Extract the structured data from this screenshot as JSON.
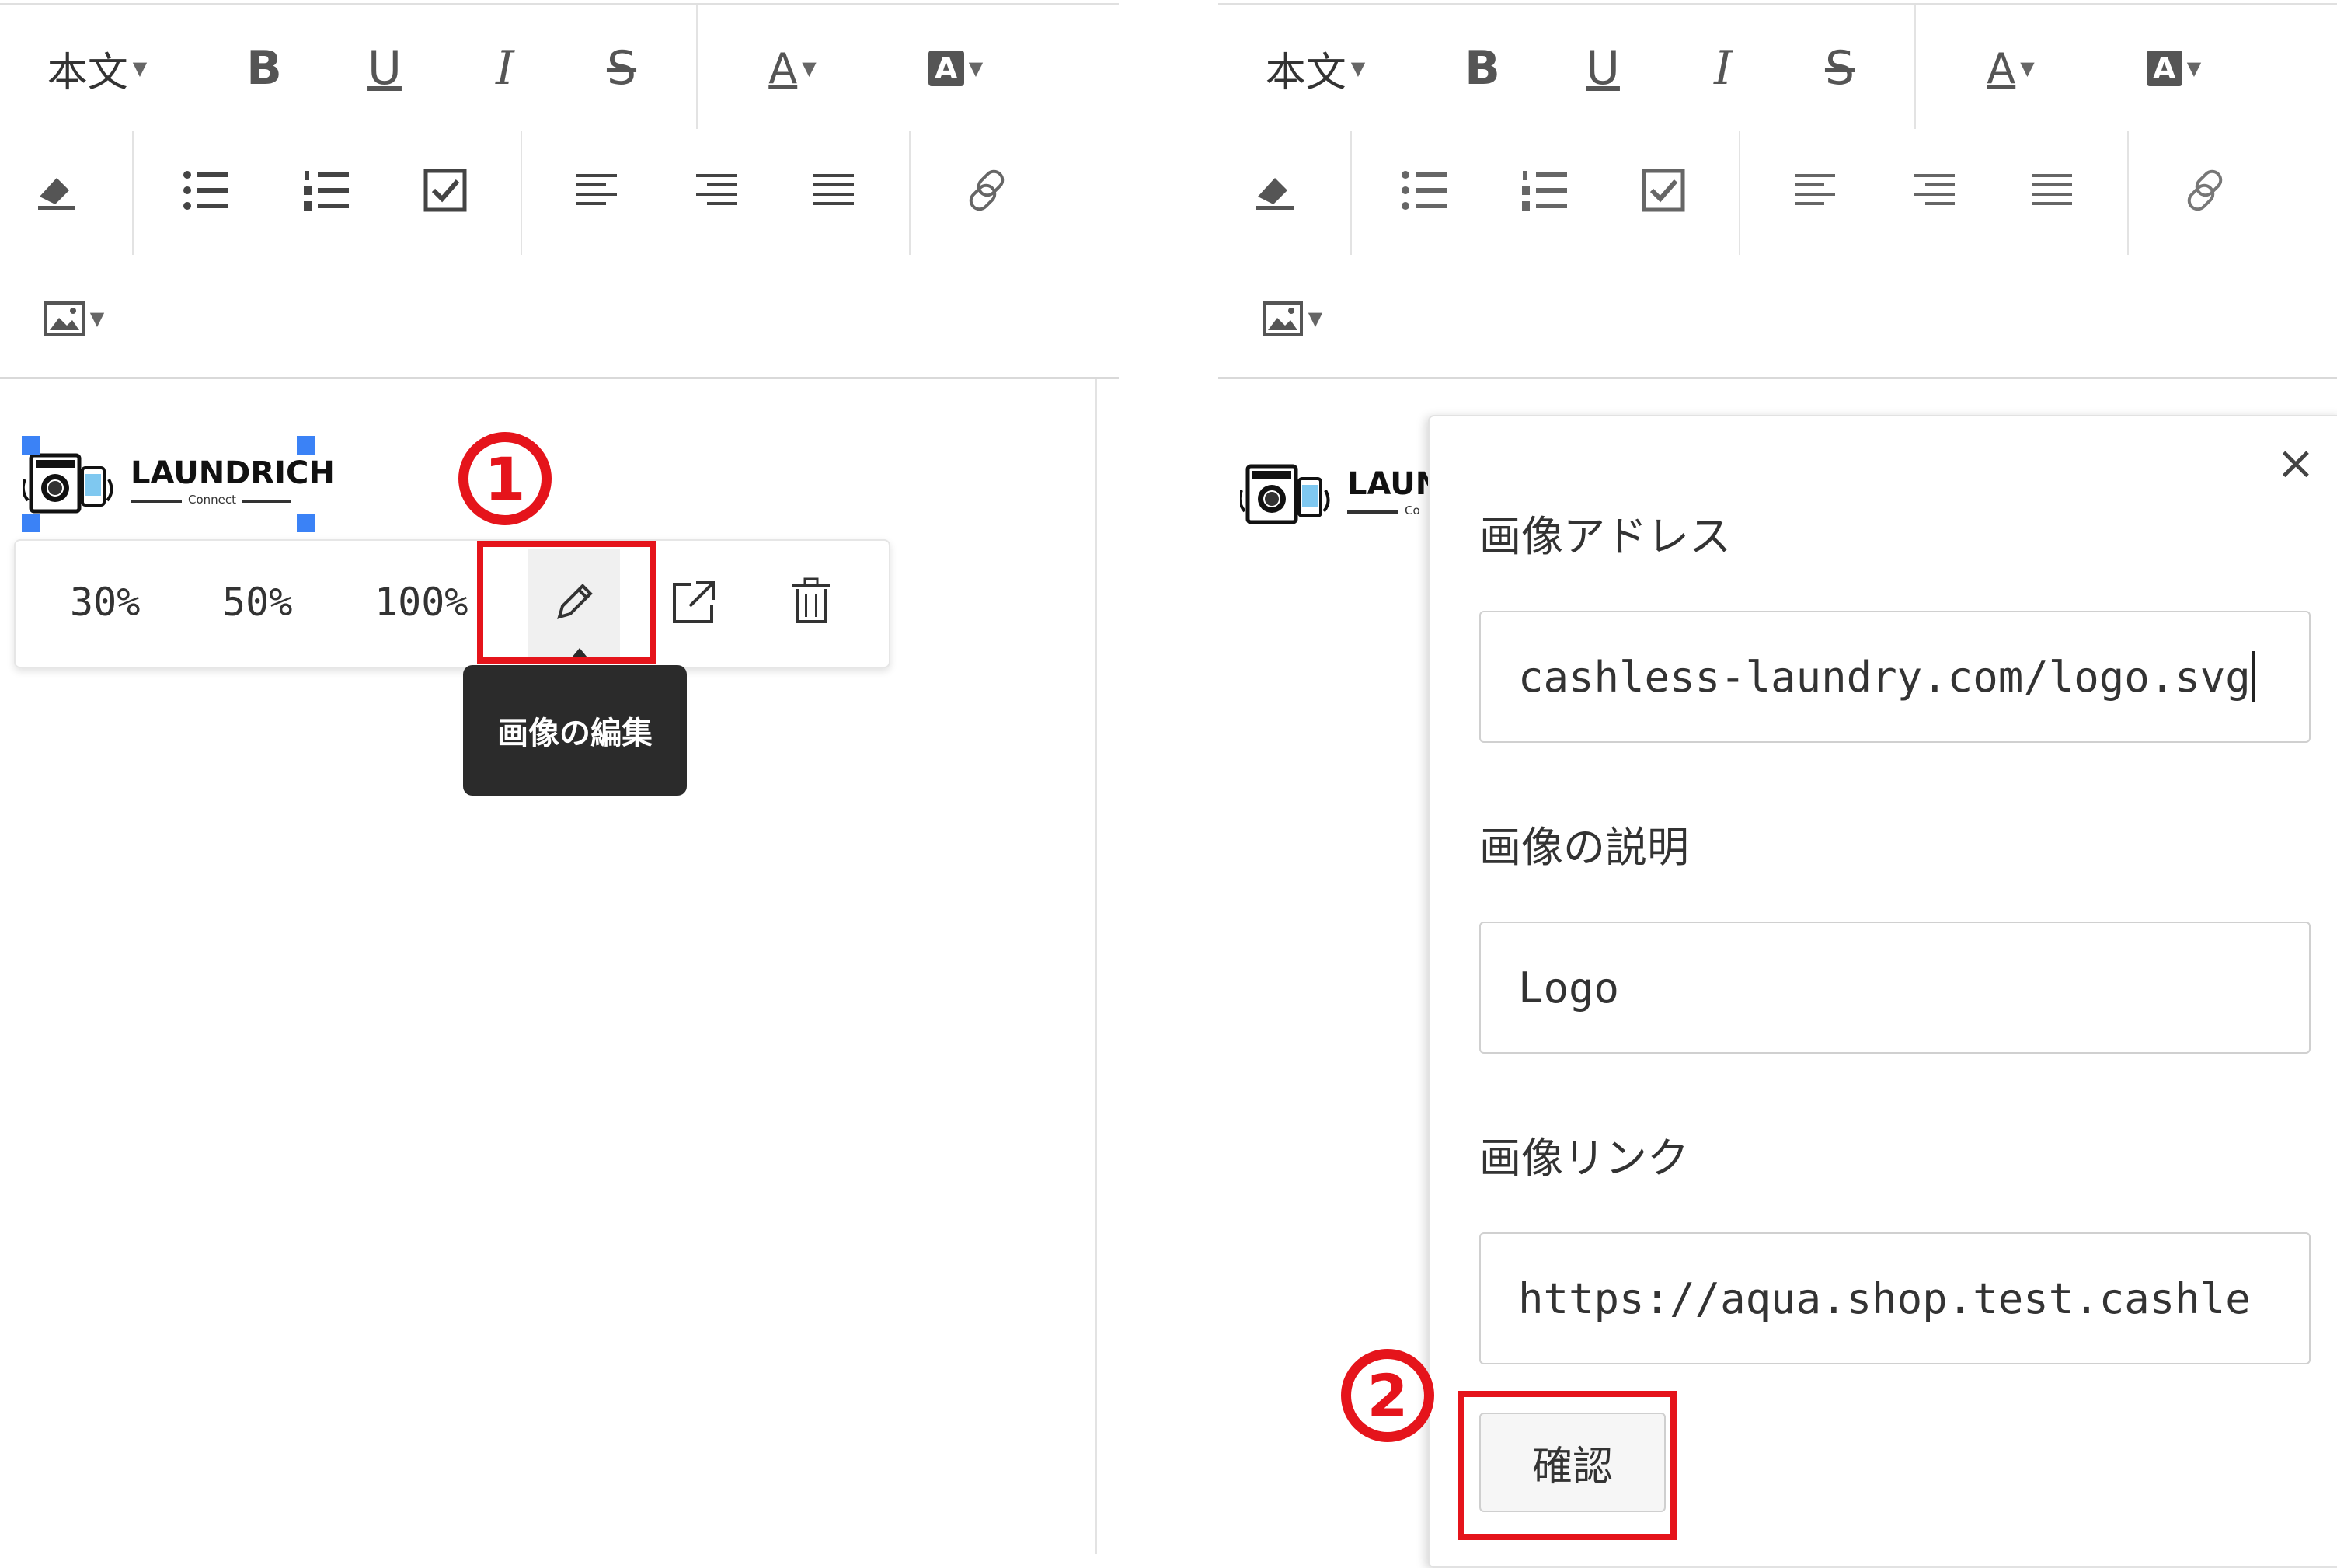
{
  "left_editor": {
    "toolbar": {
      "paragraph_style": "本文",
      "bold": "B",
      "underline": "U",
      "italic": "I",
      "strike": "S",
      "font_color": "A",
      "bg_color": "A"
    },
    "logo": {
      "name": "LAUNDRICH",
      "sub": "Connect"
    },
    "image_bubble": {
      "size_30": "30%",
      "size_50": "50%",
      "size_100": "100%",
      "tooltip": "画像の編集"
    },
    "step_marker": "1"
  },
  "right_editor": {
    "toolbar": {
      "paragraph_style": "本文",
      "bold": "B",
      "underline": "U",
      "italic": "I",
      "strike": "S",
      "font_color": "A",
      "bg_color": "A"
    },
    "logo": {
      "name": "LAUN",
      "sub": "Co"
    },
    "dialog": {
      "close": "×",
      "image_address_label": "画像アドレス",
      "image_address_value": "cashless-laundry.com/logo.svg",
      "image_description_label": "画像の説明",
      "image_description_value": "Logo",
      "image_link_label": "画像リンク",
      "image_link_value": "https://aqua.shop.test.cashle",
      "confirm_button": "確認"
    },
    "step_marker": "2"
  },
  "colors": {
    "highlight_red": "#e5141b",
    "selection_blue": "#3b82f6",
    "tooltip_bg": "#2b2b2b"
  }
}
